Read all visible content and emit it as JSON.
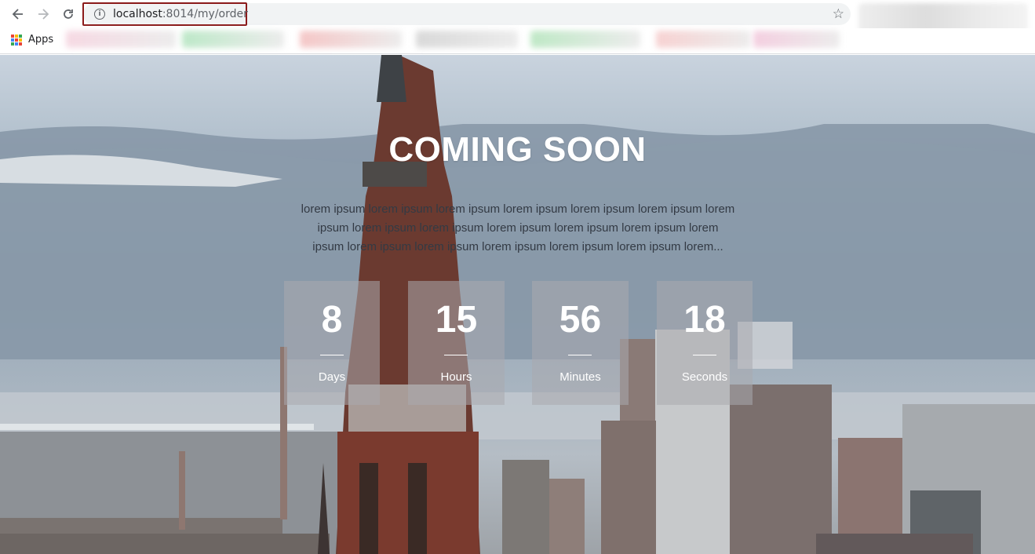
{
  "browser": {
    "back_icon": "arrow-left-icon",
    "forward_icon": "arrow-right-icon",
    "reload_icon": "reload-icon",
    "url_host": "localhost",
    "url_rest": ":8014/my/order",
    "bookmark_icon": "star-icon",
    "apps_label": "Apps",
    "highlight_color": "#8b1a1a"
  },
  "page": {
    "title": "COMING SOON",
    "description_lines": [
      "lorem ipsum lorem ipsum lorem ipsum lorem ipsum lorem ipsum lorem ipsum lorem",
      "ipsum lorem ipsum lorem ipsum lorem ipsum lorem ipsum lorem ipsum lorem",
      "ipsum lorem ipsum lorem ipsum lorem ipsum lorem ipsum lorem ipsum lorem..."
    ],
    "countdown": [
      {
        "value": "8",
        "label": "Days"
      },
      {
        "value": "15",
        "label": "Hours"
      },
      {
        "value": "56",
        "label": "Minutes"
      },
      {
        "value": "18",
        "label": "Seconds"
      }
    ]
  }
}
